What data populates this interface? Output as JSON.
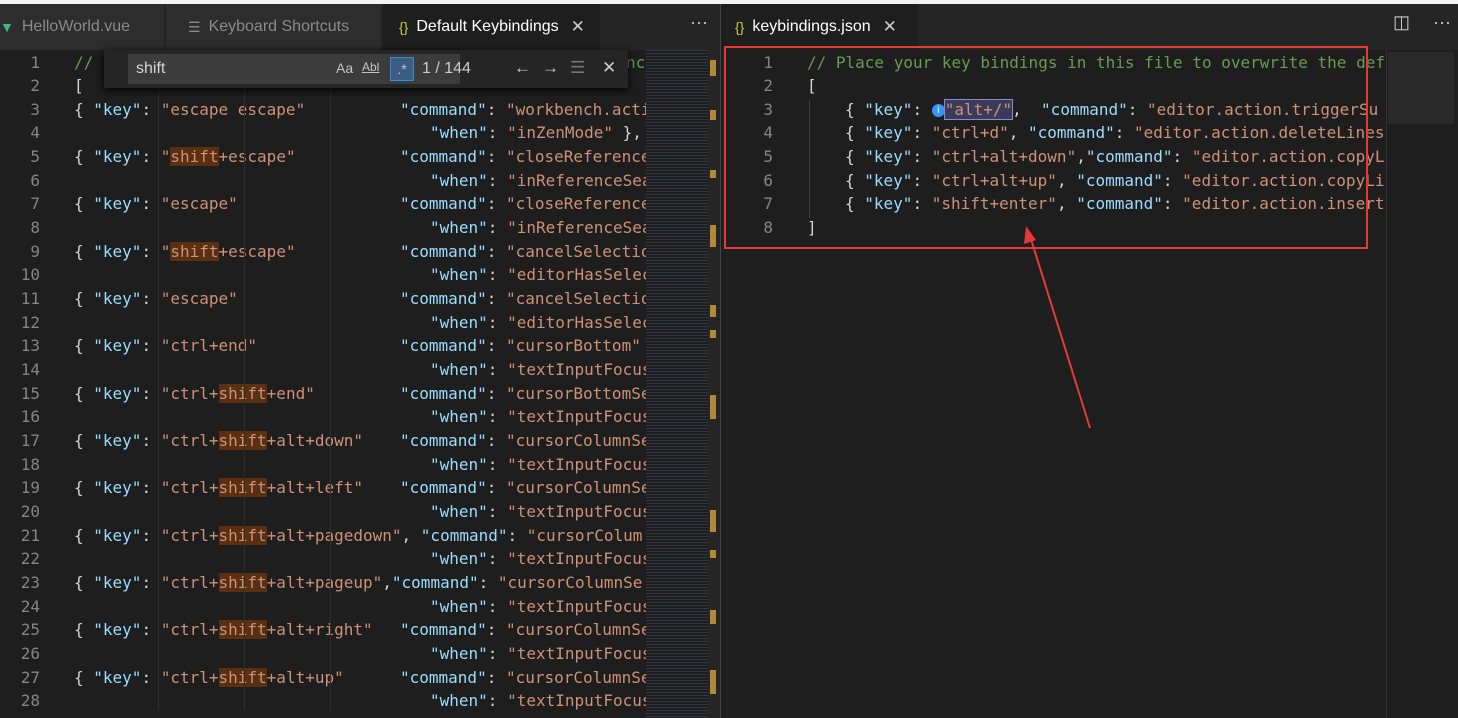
{
  "left_tabs": [
    {
      "label": "HelloWorld.vue",
      "icon": "vue-icon"
    },
    {
      "label": "Keyboard Shortcuts",
      "icon": "list-icon"
    },
    {
      "label": "Default Keybindings",
      "icon": "json-braces-icon",
      "active": true
    }
  ],
  "right_tab": {
    "label": "keybindings.json",
    "icon": "json-braces-icon"
  },
  "find": {
    "query": "shift",
    "count": "1 / 144",
    "match_case": "Aa",
    "whole_word": "Abl",
    "regex": ".*"
  },
  "left_code": [
    {
      "n": "1"
    },
    {
      "n": "2"
    },
    {
      "n": "3"
    },
    {
      "n": "4"
    },
    {
      "n": "5"
    },
    {
      "n": "6"
    },
    {
      "n": "7"
    },
    {
      "n": "8"
    },
    {
      "n": "9"
    },
    {
      "n": "10"
    },
    {
      "n": "11"
    },
    {
      "n": "12"
    },
    {
      "n": "13"
    },
    {
      "n": "14"
    },
    {
      "n": "15"
    },
    {
      "n": "16"
    },
    {
      "n": "17"
    },
    {
      "n": "18"
    },
    {
      "n": "19"
    },
    {
      "n": "20"
    },
    {
      "n": "21"
    },
    {
      "n": "22"
    },
    {
      "n": "23"
    },
    {
      "n": "24"
    },
    {
      "n": "25"
    },
    {
      "n": "26"
    },
    {
      "n": "27"
    },
    {
      "n": "28"
    }
  ],
  "left_text": {
    "l1": "// ",
    "l1_end": "nc",
    "l2": "[",
    "open": "{ ",
    "key": "\"key\"",
    "colon": ": ",
    "command": "\"command\"",
    "when": "\"when\"",
    "k3": "\"escape escape\"",
    "c3": "\"workbench.acti",
    "w4": "\"inZenMode\"",
    "w4_tail": " },",
    "k5a": "\"",
    "k5b": "shift",
    "k5c": "+escape\"",
    "c5": "\"closeReference",
    "w6": "\"inReferenceSea",
    "k7": "\"escape\"",
    "c7": "\"closeReference",
    "w8": "\"inReferenceSea",
    "k9a": "\"",
    "k9b": "shift",
    "k9c": "+escape\"",
    "c9": "\"cancelSelectio",
    "w10": "\"editorHasSelec",
    "k11": "\"escape\"",
    "c11": "\"cancelSelectio",
    "w12": "\"editorHasSelec",
    "k13": "\"ctrl+end\"",
    "c13": "\"cursorBottom\"",
    "w14": "\"textInputFocus",
    "k15a": "\"ctrl+",
    "k15b": "shift",
    "k15c": "+end\"",
    "c15": "\"cursorBottomSe",
    "w16": "\"textInputFocus",
    "k17a": "\"ctrl+",
    "k17b": "shift",
    "k17c": "+alt+down\"",
    "c17": "\"cursorColumnSe",
    "w18": "\"textInputFocus",
    "k19a": "\"ctrl+",
    "k19b": "shift",
    "k19c": "+alt+left\"",
    "c19": "\"cursorColumnSe",
    "w20": "\"textInputFocus",
    "k21a": "\"ctrl+",
    "k21b": "shift",
    "k21c": "+alt+pagedown\"",
    "c21": "\"cursorColum",
    "w22": "\"textInputFocus",
    "k23a": "\"ctrl+",
    "k23b": "shift",
    "k23c": "+alt+pageup\"",
    "c23": "\"cursorColumnSe",
    "w24": "\"textInputFocus",
    "k25a": "\"ctrl+",
    "k25b": "shift",
    "k25c": "+alt+right\"",
    "c25": "\"cursorColumnSe",
    "w26": "\"textInputFocus",
    "k27a": "\"ctrl+",
    "k27b": "shift",
    "k27c": "+alt+up\"",
    "c27": "\"cursorColumnSe",
    "w28": "\"textInputFocus"
  },
  "right_code": {
    "lines": [
      "1",
      "2",
      "3",
      "4",
      "5",
      "6",
      "7",
      "8"
    ],
    "comment": "// Place your key bindings in this file to overwrite the def",
    "open_bracket": "[",
    "close_bracket": "]",
    "r3_key": "\"alt+/\"",
    "r3_cmd": "\"editor.action.triggerSu",
    "r4_key": "\"ctrl+d\"",
    "r4_cmd": "\"editor.action.deleteLines\"",
    "r5_key": "\"ctrl+alt+down\"",
    "r5_cmd": "\"editor.action.copyLi",
    "r6_key": "\"ctrl+alt+up\"",
    "r6_cmd": "\"editor.action.copyLin",
    "r7_key": "\"shift+enter\"",
    "r7_cmd": "\"editor.action.insertL"
  },
  "colors": {
    "annotation": "#e53935",
    "find_highlight": "#5b2f12",
    "keyword": "#9cdcfe",
    "string": "#ce9178",
    "comment": "#6a9955"
  }
}
